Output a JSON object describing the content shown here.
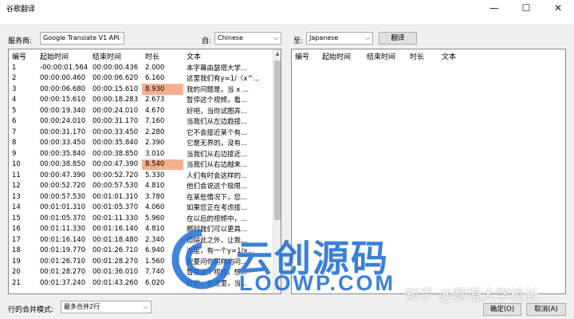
{
  "window": {
    "title": "谷歌翻译",
    "minimize": "—",
    "maximize": "☐",
    "close": "✕"
  },
  "service": {
    "label": "服务商:",
    "value": "Google Translate V1 API"
  },
  "from": {
    "label": "自:",
    "value": "Chinese"
  },
  "to": {
    "label": "至:",
    "value": "Japanese"
  },
  "translate_button": "翻译",
  "columns": [
    "编号",
    "起始时间",
    "结束时间",
    "时长",
    "文本"
  ],
  "rows": [
    {
      "n": "1",
      "start": "-00:00:01.564",
      "end": "00:00:00.436",
      "dur": "2.000",
      "text": "本字幕由瑟塔大学..."
    },
    {
      "n": "2",
      "start": "00:00:00.460",
      "end": "00:00:06.620",
      "dur": "6.160",
      "text": "这里我们有y=1/〈x^..."
    },
    {
      "n": "3",
      "start": "00:00:06.680",
      "end": "00:00:15.610",
      "dur": "8.930",
      "text": "我的问题是，当 x ...",
      "hl": true
    },
    {
      "n": "4",
      "start": "00:00:15.610",
      "end": "00:00:18.283",
      "dur": "2.673",
      "text": "暂停这个视频，看..."
    },
    {
      "n": "5",
      "start": "00:00:19.340",
      "end": "00:00:24.010",
      "dur": "4.670",
      "text": "好吧，当你试图弄..."
    },
    {
      "n": "6",
      "start": "00:00:24.010",
      "end": "00:00:31.170",
      "dur": "7.160",
      "text": "当我们从左边趋接..."
    },
    {
      "n": "7",
      "start": "00:00:31.170",
      "end": "00:00:33.450",
      "dur": "2.280",
      "text": "它不会接近某个有..."
    },
    {
      "n": "8",
      "start": "00:00:33.450",
      "end": "00:00:35.840",
      "dur": "2.390",
      "text": "它是无界的，没有..."
    },
    {
      "n": "9",
      "start": "00:00:35.840",
      "end": "00:00:38.850",
      "dur": "3.010",
      "text": "当我们从右边接近..."
    },
    {
      "n": "10",
      "start": "00:00:38.850",
      "end": "00:00:47.390",
      "dur": "8.540",
      "text": "当我们从右边越来...",
      "hl": true
    },
    {
      "n": "11",
      "start": "00:00:47.390",
      "end": "00:00:52.720",
      "dur": "5.330",
      "text": "人们有时会这样的..."
    },
    {
      "n": "12",
      "start": "00:00:52.720",
      "end": "00:00:57.530",
      "dur": "4.810",
      "text": "他们会说这个极限..."
    },
    {
      "n": "13",
      "start": "00:00:57.530",
      "end": "00:01:01.310",
      "dur": "3.780",
      "text": "在某些情况下，您..."
    },
    {
      "n": "14",
      "start": "00:01:01.310",
      "end": "00:01:05.370",
      "dur": "4.060",
      "text": "如果您正在考虑接..."
    },
    {
      "n": "15",
      "start": "00:01:05.370",
      "end": "00:01:11.330",
      "dur": "5.960",
      "text": "在以后的视频中，..."
    },
    {
      "n": "16",
      "start": "00:01:11.330",
      "end": "00:01:16.140",
      "dur": "4.810",
      "text": "那时我们可以更具..."
    },
    {
      "n": "17",
      "start": "00:01:16.140",
      "end": "00:01:18.480",
      "dur": "2.340",
      "text": "但除此之外，让我..."
    },
    {
      "n": "18",
      "start": "00:01:19.770",
      "end": "00:01:26.710",
      "dur": "6.940",
      "text": "这里，有一个y=1/x..."
    },
    {
      "n": "19",
      "start": "00:01:26.710",
      "end": "00:01:28.270",
      "dur": "1.560",
      "text": "我要问你同样的问..."
    },
    {
      "n": "20",
      "start": "00:01:28.270",
      "end": "00:01:36.010",
      "dur": "7.740",
      "text": "暂停这个视频，想..."
    },
    {
      "n": "21",
      "start": "00:01:37.240",
      "end": "00:01:43.260",
      "dur": "6.020",
      "text": "好的，在这里，当..."
    }
  ],
  "merge": {
    "label": "行的合并模式:",
    "value": "最多合并2行"
  },
  "ok_button": "确定(O)",
  "cancel_button": "取消(A)",
  "watermark": {
    "brand": "云创源码",
    "url": "LOOWP.COM",
    "credit": "知乎 @瑟塔大学校长"
  },
  "colors": {
    "highlight": "#f4b08e",
    "watermark_blue": "#1f6fd6"
  }
}
